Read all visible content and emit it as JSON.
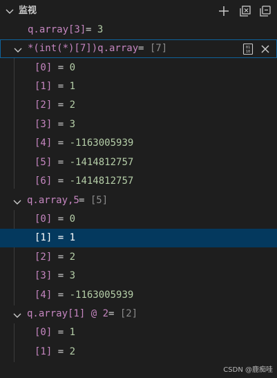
{
  "header": {
    "title": "监视",
    "add_icon": "plus-icon",
    "collapse_icon": "collapse-all-icon",
    "copy_icon": "copy-icon"
  },
  "watch": {
    "item1": {
      "expr": "q.array[3]",
      "eq": " = ",
      "value": "3"
    },
    "item2": {
      "expr": "*(int(*)[7])q.array",
      "eq": " = ",
      "value": "[7]",
      "children": [
        {
          "idx": "[0]",
          "value": "0"
        },
        {
          "idx": "[1]",
          "value": "1"
        },
        {
          "idx": "[2]",
          "value": "2"
        },
        {
          "idx": "[3]",
          "value": "3"
        },
        {
          "idx": "[4]",
          "value": "-1163005939"
        },
        {
          "idx": "[5]",
          "value": "-1414812757"
        },
        {
          "idx": "[6]",
          "value": "-1414812757"
        }
      ]
    },
    "item3": {
      "expr": "q.array,5",
      "eq": " = ",
      "value": "[5]",
      "children": [
        {
          "idx": "[0]",
          "value": "0"
        },
        {
          "idx": "[1]",
          "value": "1"
        },
        {
          "idx": "[2]",
          "value": "2"
        },
        {
          "idx": "[3]",
          "value": "3"
        },
        {
          "idx": "[4]",
          "value": "-1163005939"
        }
      ]
    },
    "item4": {
      "expr": "q.array[1] @ 2",
      "eq": " = ",
      "value": "[2]",
      "children": [
        {
          "idx": "[0]",
          "value": "1"
        },
        {
          "idx": "[1]",
          "value": "2"
        }
      ]
    }
  },
  "eq": " = ",
  "watermark": "CSDN @鹿痴哇",
  "colors": {
    "background": "#1e1e1e",
    "name": "#c586c0",
    "number": "#b5cea8",
    "selection": "#04395e",
    "focus_border": "#0e639c"
  }
}
